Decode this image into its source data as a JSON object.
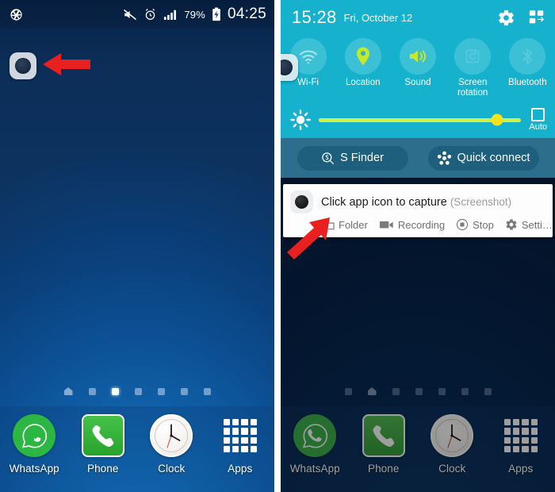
{
  "left_phone": {
    "status_bar": {
      "icons": [
        "camera-shutter-icon",
        "mute-icon",
        "alarm-icon",
        "signal-icon"
      ],
      "battery_percent": "79%",
      "clock": "04:25"
    },
    "floating_button": {
      "name": "screenshot-capture-floating-button"
    },
    "page_indicator": {
      "count": 7,
      "active_index": 2,
      "home_index": 0
    },
    "dock": [
      {
        "label": "WhatsApp",
        "icon": "whatsapp-icon"
      },
      {
        "label": "Phone",
        "icon": "phone-icon"
      },
      {
        "label": "Clock",
        "icon": "clock-icon"
      },
      {
        "label": "Apps",
        "icon": "apps-grid-icon"
      }
    ]
  },
  "right_phone": {
    "quick_settings": {
      "time": "15:28",
      "date": "Fri, October 12",
      "settings_icon": "gear-icon",
      "edit_icon": "edit-quick-settings-icon",
      "toggles": [
        {
          "label": "Wi-Fi",
          "icon": "wifi-icon",
          "state": "off"
        },
        {
          "label": "Location",
          "icon": "location-pin-icon",
          "state": "on"
        },
        {
          "label": "Sound",
          "icon": "speaker-icon",
          "state": "on"
        },
        {
          "label": "Screen rotation",
          "icon": "rotation-icon",
          "state": "off"
        },
        {
          "label": "Bluetooth",
          "icon": "bluetooth-icon",
          "state": "off"
        }
      ],
      "brightness": {
        "icon": "brightness-sun-icon",
        "value_percent": 88,
        "auto_label": "Auto",
        "auto_checked": false
      },
      "actions": [
        {
          "label": "S Finder",
          "icon": "s-finder-icon"
        },
        {
          "label": "Quick connect",
          "icon": "quick-connect-icon"
        }
      ]
    },
    "notification": {
      "icon": "screenshot-app-icon",
      "title": "Click app icon to capture",
      "subtitle": "(Screenshot)",
      "actions": [
        {
          "label": "Folder",
          "icon": "folder-icon"
        },
        {
          "label": "Recording",
          "icon": "video-camera-icon"
        },
        {
          "label": "Stop",
          "icon": "stop-icon"
        },
        {
          "label": "Setti…",
          "icon": "gear-icon"
        }
      ]
    },
    "floating_button": {
      "name": "screenshot-capture-floating-button"
    },
    "page_indicator": {
      "count": 7,
      "active_index": -1,
      "home_index": 1
    },
    "dock": [
      {
        "label": "WhatsApp",
        "icon": "whatsapp-icon"
      },
      {
        "label": "Phone",
        "icon": "phone-icon"
      },
      {
        "label": "Clock",
        "icon": "clock-icon"
      },
      {
        "label": "Apps",
        "icon": "apps-grid-icon"
      }
    ]
  },
  "annotations": {
    "arrow_left": "red-arrow-pointing-left",
    "arrow_right": "red-arrow-pointing-up-right"
  },
  "colors": {
    "accent_cyan": "#16b1cd",
    "toggle_circle": "#3cc0d6",
    "toggle_on_green": "#c6e82a",
    "action_band": "#2c6e8c",
    "pill": "#1e5f7e",
    "arrow_red": "#e8201f",
    "wallpaper_blue": "#0c5094"
  }
}
